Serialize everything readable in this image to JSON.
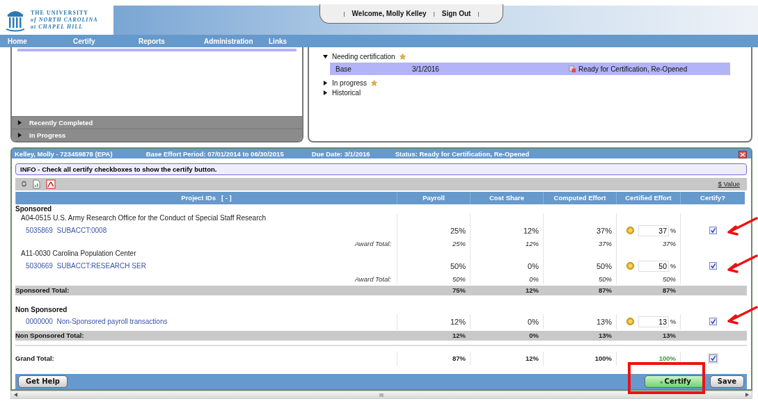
{
  "logo": {
    "lines": [
      "THE UNIVERSITY",
      "of NORTH CAROLINA",
      "at CHAPEL HILL"
    ]
  },
  "user_bar": {
    "welcome": "Welcome, Molly Kelley",
    "sign_out": "Sign Out",
    "separator": "|"
  },
  "nav": [
    {
      "label": "Home"
    },
    {
      "label": "Certify"
    },
    {
      "label": "Reports"
    },
    {
      "label": "Administration"
    },
    {
      "label": "Links"
    }
  ],
  "left_panel": {
    "sections": [
      {
        "label": "Recently Completed",
        "expanded": false
      },
      {
        "label": "In Progress",
        "expanded": false
      }
    ]
  },
  "tree": [
    {
      "label": "Needing certification",
      "expanded": true,
      "starred": true,
      "children": [
        {
          "label": "Base",
          "date": "3/1/2016",
          "status": "Ready for Certification, Re-Opened",
          "selected": true
        }
      ]
    },
    {
      "label": "In progress",
      "expanded": false,
      "starred": true
    },
    {
      "label": "Historical",
      "expanded": false,
      "starred": false
    }
  ],
  "statement": {
    "title_parts": [
      "Kelley, Molly - 723459878 (EPA)",
      "Base Effort Period: 07/01/2014 to 06/30/2015",
      "Due Date: 3/1/2016",
      "Status: Ready for Certification, Re-Opened"
    ],
    "info": "INFO - Check all certify checkboxes to show the certify button.",
    "value_link": "$ Value",
    "columns": [
      "Project IDs   [ - ]",
      "Payroll",
      "Cost Share",
      "Computed Effort",
      "Certified Effort",
      "Certify?"
    ],
    "rows": [
      {
        "kind": "group",
        "label": "Sponsored"
      },
      {
        "kind": "award",
        "label": "A04-0515 U.S. Army Research Office for the Conduct of Special Staff Research"
      },
      {
        "kind": "account",
        "label": "5035869  SUBACCT:0008",
        "values": [
          "25%",
          "12%",
          "37%"
        ],
        "certified": "37",
        "unit": "%",
        "checked": true
      },
      {
        "kind": "award_total",
        "label": "Award Total:",
        "values": [
          "25%",
          "12%",
          "37%",
          "37%"
        ]
      },
      {
        "kind": "award",
        "label": "A11-0030 Carolina Population Center"
      },
      {
        "kind": "account",
        "label": "5030669  SUBACCT:RESEARCH SER",
        "values": [
          "50%",
          "0%",
          "50%"
        ],
        "certified": "50",
        "unit": "%",
        "checked": true
      },
      {
        "kind": "award_total",
        "label": "Award Total:",
        "values": [
          "50%",
          "0%",
          "50%",
          "50%"
        ]
      },
      {
        "kind": "subtotal",
        "label": "Sponsored Total:",
        "values": [
          "75%",
          "12%",
          "87%",
          "87%"
        ]
      },
      {
        "kind": "group",
        "label": "Non Sponsored"
      },
      {
        "kind": "account",
        "label": "0000000  Non-Sponsored payroll transactions",
        "values": [
          "12%",
          "0%",
          "13%"
        ],
        "certified": "13",
        "unit": "%",
        "checked": true
      },
      {
        "kind": "subtotal",
        "label": "Non Sponsored Total:",
        "values": [
          "12%",
          "0%",
          "13%",
          "13%"
        ]
      },
      {
        "kind": "grand",
        "label": "Grand Total:",
        "values": [
          "87%",
          "12%",
          "100%",
          "100%"
        ],
        "checked": true
      }
    ],
    "buttons": {
      "help": "Get Help",
      "certify": "Certify",
      "save": "Save"
    }
  },
  "scroll_grip": "III"
}
